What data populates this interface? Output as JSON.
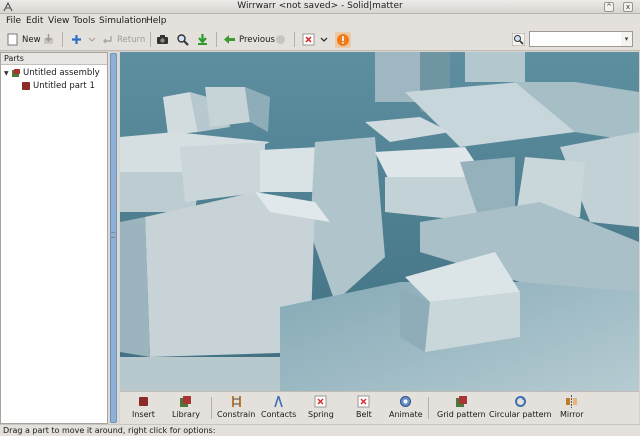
{
  "window": {
    "title": "Wirrwarr <not saved> - Solid|matter",
    "buttons": [
      "^",
      "x"
    ]
  },
  "menu": [
    {
      "label": "File"
    },
    {
      "label": "Edit"
    },
    {
      "label": "View"
    },
    {
      "label": "Tools"
    },
    {
      "label": "Simulation"
    },
    {
      "label": "Help"
    }
  ],
  "toolbar": {
    "new_label": "New",
    "return_label": "Return",
    "previous_label": "Previous",
    "search_value": ""
  },
  "parts_panel": {
    "header": "Parts",
    "tree": [
      {
        "label": "Untitled assembly",
        "expanded": true
      },
      {
        "label": "Untitled part 1"
      }
    ]
  },
  "bottom_tools": [
    {
      "label": "Insert",
      "icon": "insert-icon"
    },
    {
      "label": "Library",
      "icon": "library-icon"
    },
    {
      "label": "Constrain",
      "icon": "constrain-icon"
    },
    {
      "label": "Contacts",
      "icon": "contacts-icon"
    },
    {
      "label": "Spring",
      "icon": "spring-icon"
    },
    {
      "label": "Belt",
      "icon": "belt-icon"
    },
    {
      "label": "Animate",
      "icon": "animate-icon"
    },
    {
      "label": "Grid pattern",
      "icon": "grid-pattern-icon"
    },
    {
      "label": "Circular pattern",
      "icon": "circular-pattern-icon"
    },
    {
      "label": "Mirror",
      "icon": "mirror-icon"
    }
  ],
  "status": "Drag a part to move it around, right click for options:",
  "colors": {
    "accent_orange": "#f07a1a",
    "scrollbar": "#8eb0d6",
    "scene_background": "#4a7a8a",
    "block_face": "#c6d0d4"
  }
}
